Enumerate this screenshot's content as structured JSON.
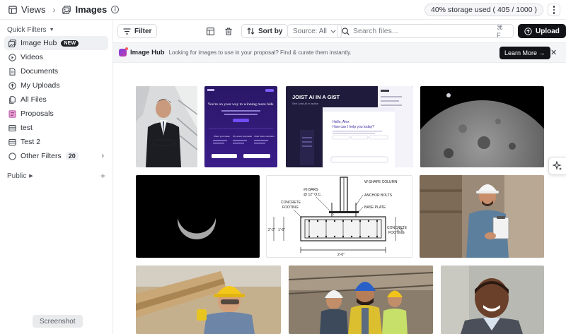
{
  "topbar": {
    "views_label": "Views",
    "page_title": "Images",
    "info_glyph": "i",
    "storage": "40% storage used ( 405 / 1000 )"
  },
  "sidebar": {
    "quick_filters_label": "Quick Filters",
    "items": [
      {
        "label": "Image Hub",
        "badge": "NEW",
        "icon": "image-hub-icon"
      },
      {
        "label": "Videos",
        "icon": "play-circle-icon"
      },
      {
        "label": "Documents",
        "icon": "document-icon"
      },
      {
        "label": "My Uploads",
        "icon": "upload-circle-icon"
      },
      {
        "label": "All Files",
        "icon": "files-icon"
      },
      {
        "label": "Proposals",
        "icon": "proposal-icon"
      },
      {
        "label": "test",
        "icon": "folder-icon"
      },
      {
        "label": "Test 2",
        "icon": "folder-icon"
      },
      {
        "label": "Other Filters",
        "count": "20",
        "icon": "circle-icon"
      }
    ],
    "public_label": "Public",
    "screenshot_label": "Screenshot"
  },
  "toolbar": {
    "filter_label": "Filter",
    "sort_label": "Sort by",
    "source_label": "Source: All",
    "search_placeholder": "Search files...",
    "search_shortcut": "⌘ F",
    "upload_label": "Upload"
  },
  "banner": {
    "name": "Image Hub",
    "message": "Looking for images to use in your proposal? Find & curate them instantly.",
    "learn_more": "Learn More →"
  },
  "images": {
    "presentation": {
      "title": "You're on your way to winning more bids",
      "col1": "Share your ideas",
      "col2": "My recent proposals",
      "col3": "Invite Team members"
    },
    "joist_ai": {
      "title": "JOIST AI IN A GIST",
      "subtitle": "See Joist AI in action",
      "greeting": "Hello, Alex",
      "prompt": "How can I help you today?"
    },
    "drawing": {
      "w_shape": "W-SHAPE COLUMN",
      "anchor": "ANCHOR BOLTS",
      "bars_1": "#6 BARS",
      "bars_2": "@ 12\" O.C.",
      "base_plate": "BASE PLATE",
      "concrete_left_1": "CONCRETE",
      "concrete_left_2": "FOOTING",
      "concrete_right_1": "CONCRETE",
      "concrete_right_2": "FOOTING",
      "dim_bottom": "2'-0\"",
      "dim_left": "2'-0\"",
      "dim_left_inner": "1'-6\"",
      "dim_right": "1'-6\""
    }
  }
}
